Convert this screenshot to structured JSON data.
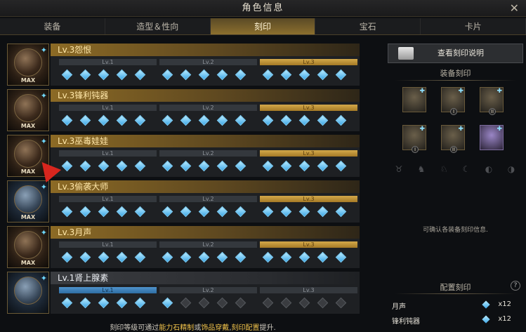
{
  "window": {
    "title": "角色信息",
    "close": "✕"
  },
  "tabs": [
    "装备",
    "造型＆性向",
    "刻印",
    "宝石",
    "卡片"
  ],
  "active_tab": 2,
  "level_labels": [
    "Lv.1",
    "Lv.2",
    "Lv.3"
  ],
  "engravings": [
    {
      "name": "Lv.3怨恨",
      "level": 3,
      "max": "MAX",
      "filled": 15
    },
    {
      "name": "Lv.3锋利钝器",
      "level": 3,
      "max": "MAX",
      "filled": 15
    },
    {
      "name": "Lv.3巫毒娃娃",
      "level": 3,
      "max": "MAX",
      "filled": 15
    },
    {
      "name": "Lv.3偷袭大师",
      "level": 3,
      "max": "MAX",
      "filled": 15
    },
    {
      "name": "Lv.3月声",
      "level": 3,
      "max": "MAX",
      "filled": 15
    },
    {
      "name": "Lv.1肾上腺素",
      "level": 1,
      "max": "",
      "filled": 6
    }
  ],
  "right": {
    "explain_button": "查看刻印说明",
    "equip_title": "装备刻印",
    "equip_numerals": [
      "",
      "I",
      "II",
      "I",
      "II",
      ""
    ],
    "slot_glyphs": [
      "♉",
      "♞",
      "♘",
      "☾",
      "◐",
      "◑"
    ],
    "info_text": "可确认各装备刻印信息.",
    "config_title": "配置刻印",
    "help": "?",
    "config": [
      {
        "name": "月声",
        "value": "x12"
      },
      {
        "name": "锋利钝器",
        "value": "x12"
      }
    ]
  },
  "footer": {
    "prefix": "刻印等级可通过",
    "hl1": "能力石精制",
    "mid1": "或",
    "hl2": "饰品穿戴",
    "mid2": ",",
    "hl3": "刻印配置",
    "suffix": "提升."
  },
  "colors": {
    "gold": "#d4a94a",
    "blue_seg": "#4f93cc",
    "gem": "#3ea8e8",
    "flag": "#d8261e"
  }
}
